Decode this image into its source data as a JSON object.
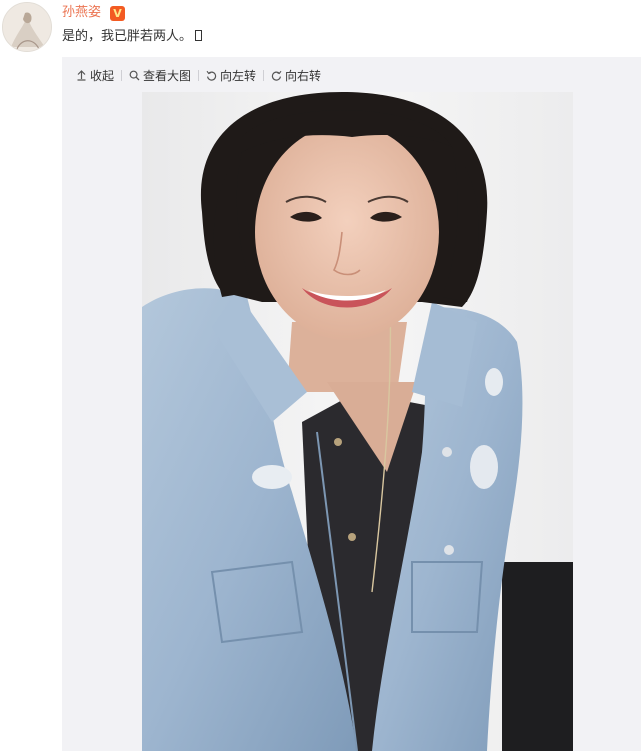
{
  "post": {
    "author": "孙燕姿",
    "verified_badge": "V",
    "text": "是的，我已胖若两人。",
    "text_trailing_icon": "missing-emoji-box-icon"
  },
  "toolbar": {
    "collapse": {
      "label": "收起",
      "icon": "arrow-up-icon"
    },
    "view_large": {
      "label": "查看大图",
      "icon": "magnifier-icon"
    },
    "rotate_left": {
      "label": "向左转",
      "icon": "rotate-left-icon"
    },
    "rotate_right": {
      "label": "向右转",
      "icon": "rotate-right-icon"
    }
  },
  "photo": {
    "subject": "selfie",
    "colors": {
      "background": "#f1f1f1",
      "denim": "#9fb8d2",
      "hair": "#1f1a18",
      "top": "#2a2a2d",
      "skin": "#e8c1ad"
    }
  },
  "colors": {
    "author_name": "#eb7350",
    "badge": "#f35b22",
    "media_background": "#f2f2f5",
    "text": "#333333"
  }
}
